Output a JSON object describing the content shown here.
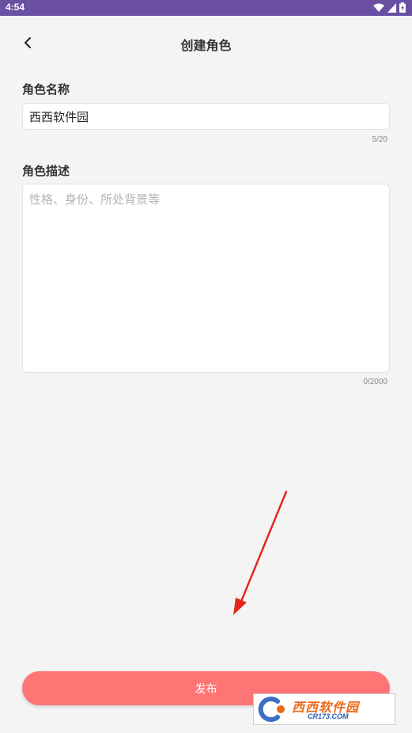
{
  "status_bar": {
    "time": "4:54"
  },
  "header": {
    "title": "创建角色"
  },
  "role_name": {
    "label": "角色名称",
    "value": "西西软件园",
    "counter": "5/20"
  },
  "role_description": {
    "label": "角色描述",
    "placeholder": "性格、身份、所处背景等",
    "value": "",
    "counter": "0/2000"
  },
  "actions": {
    "publish_label": "发布"
  },
  "watermark": {
    "text": "西西软件园",
    "sub": "CR173.COM"
  },
  "colors": {
    "status_bar": "#6a4fa3",
    "publish_button": "#ff7575",
    "background": "#f4f4f4",
    "annotation_arrow": "#e0281e"
  }
}
